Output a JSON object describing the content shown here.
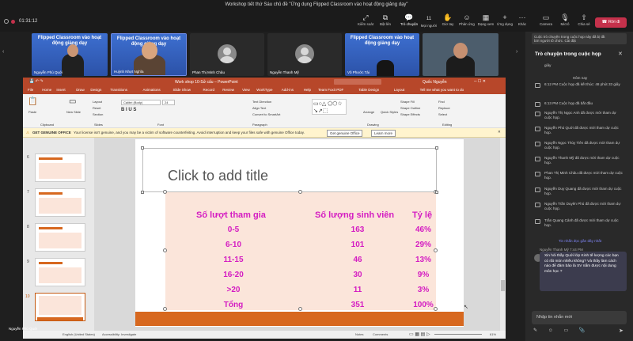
{
  "window": {
    "title": "Workshop tiết thứ Sáu chủ đề \"Ứng dụng Flipped Classroom vào hoạt động giảng dạy\"",
    "timer": "01:31:12"
  },
  "toolbar": {
    "items": [
      "Kiểm soát",
      "Bật lên",
      "Trò chuyện",
      "Mọi người",
      "Giơ tay",
      "Phản ứng",
      "Dạng xem",
      "Ứng dụng",
      "Khác",
      "Camera",
      "Micrô",
      "Chia sẻ"
    ],
    "participants_count": "11",
    "leave": "Rời đi"
  },
  "video": {
    "tiles": [
      {
        "name": "Nguyễn Phú Quới"
      },
      {
        "name": "Huỳnh Nhựt Nghĩa"
      },
      {
        "name": "Phan Thị Minh Châu"
      },
      {
        "name": "Nguyễn Thanh Mỹ"
      },
      {
        "name": "Võ Phước Tài"
      },
      {
        "name": ""
      }
    ],
    "banner_text": "Flipped Classroom vào hoạt động giảng dạy"
  },
  "ppt": {
    "title": "Work shop 10-Sử cấu – PowerPoint",
    "tabs": [
      "File",
      "Home",
      "Insert",
      "Draw",
      "Design",
      "Transitions",
      "Animations",
      "Slide Show",
      "Record",
      "Review",
      "View",
      "WorkType",
      "Add-ins",
      "Help",
      "Team Foxit PDF",
      "Table Design",
      "Layout"
    ],
    "tell_me": "Tell me what you want to do",
    "user": "Quốc Nguyễn",
    "ribbon": {
      "paste": "Paste",
      "new_slide": "New Slide",
      "layout": "Layout",
      "reset": "Reset",
      "section": "Section",
      "font": "Calibri (Body)",
      "size": "24",
      "groups": [
        "Clipboard",
        "Slides",
        "Font",
        "Paragraph",
        "Drawing",
        "Editing"
      ],
      "find": "Find",
      "replace": "Replace",
      "select": "Select",
      "shape_fill": "Shape Fill",
      "shape_outline": "Shape Outline",
      "shape_effects": "Shape Effects",
      "arrange": "Arrange",
      "quick_styles": "Quick Styles",
      "text_direction": "Text Direction",
      "align_text": "Align Text",
      "convert": "Convert to SmartArt"
    },
    "notice": {
      "label": "GET GENUINE OFFICE",
      "text": "Your license isn't genuine, and you may be a victim of software counterfeiting. Avoid interruption and keep your files safe with genuine Office today.",
      "btn1": "Get genuine Office",
      "btn2": "Learn more"
    },
    "thumbnails": [
      "6",
      "7",
      "8",
      "9",
      "10"
    ],
    "status": {
      "lang": "English (United States)",
      "access": "Accessibility: Investigate",
      "notes": "Notes",
      "comments": "Comments",
      "zoom": "61%"
    }
  },
  "slide": {
    "title_placeholder": "Click to add title",
    "headers": [
      "Số lượt tham gia",
      "Số lượng sinh viên",
      "Tỷ lệ"
    ],
    "rows": [
      [
        "0-5",
        "163",
        "46%"
      ],
      [
        "6-10",
        "101",
        "29%"
      ],
      [
        "11-15",
        "46",
        "13%"
      ],
      [
        "16-20",
        "30",
        "9%"
      ],
      [
        ">20",
        "11",
        "3%"
      ],
      [
        "Tổng",
        "351",
        "100%"
      ]
    ]
  },
  "chat": {
    "notice": "Cuộc trò chuyện trong cuộc họp này đã bị tắt",
    "notice_link": "bởi người tổ chức. Cài đặt",
    "title": "Trò chuyện trong cuộc họp",
    "messages": [
      "giây",
      "Hôm nay",
      "6:12 PM  Cuộc họp đã kết thúc: 48 phút 33 giây",
      "6:13 PM  Cuộc họp đã bắt đầu",
      "Nguyễn Thị Ngọc Anh đã được mời tham dự cuộc họp.",
      "Nguyễn Phú Quới đã được mời tham dự cuộc họp.",
      "Nguyễn Ngọc Thùy Tiên đã được mời tham dự cuộc họp.",
      "Nguyễn Thanh Mỹ đã được mời tham dự cuộc họp.",
      "Phan Thị Minh Châu đã được mời tham dự cuộc họp.",
      "Nguyễn Duy Quang đã được mời tham dự cuộc họp.",
      "Nguyễn Trần Duyên Phú đã được mời tham dự cuộc họp.",
      "Trần Quang Cảnh đã được mời tham dự cuộc họp."
    ],
    "new_messages": "Tin nhắn đọc gần đây nhất",
    "last_sender": "Nguyễn Thanh Mỹ  7:44 PM",
    "last_message": "Xin hỏi thầy Quới lớp Kinh tế lượng các bạn có rất mòn nhiều không? Và thầy làm cách nào để đảm bảo là SV nắm được nội dung môn học ?",
    "input_placeholder": "Nhập tin nhắn mới"
  },
  "presenter_label": "Nguyễn Phú Quới"
}
